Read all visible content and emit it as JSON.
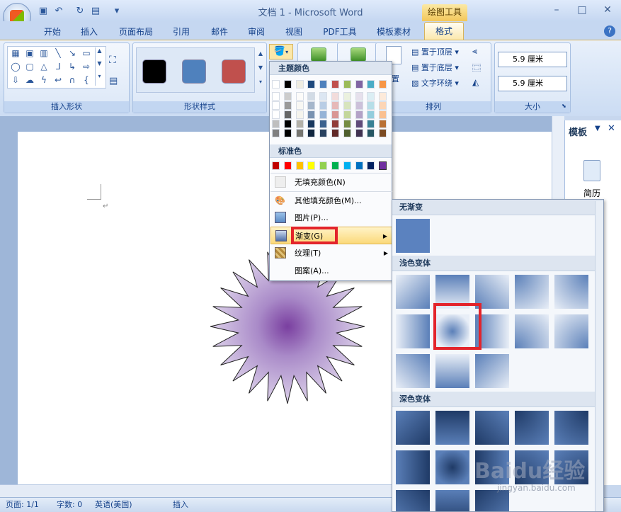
{
  "window": {
    "title": "文档 1 - Microsoft Word",
    "context_tab_group": "绘图工具"
  },
  "tabs": [
    "开始",
    "插入",
    "页面布局",
    "引用",
    "邮件",
    "审阅",
    "视图",
    "PDF工具",
    "模板素材",
    "格式"
  ],
  "active_tab": "格式",
  "ribbon": {
    "groups": {
      "insert_shapes": "插入形状",
      "shape_styles": "形状样式",
      "arrange": "排列",
      "size": "大小"
    },
    "arrange_items": {
      "bring_front": "置于顶层",
      "send_back": "置于底层",
      "text_wrap": "文字环绕",
      "position_partial": "置"
    },
    "size_values": {
      "height": "5.9 厘米",
      "width": "5.9 厘米"
    },
    "style_colors": [
      "#000000",
      "#4f81bd",
      "#c0504d"
    ]
  },
  "fill_dropdown": {
    "theme_header": "主题颜色",
    "standard_header": "标准色",
    "theme_top_row": [
      "#ffffff",
      "#000000",
      "#eeece1",
      "#1f497d",
      "#4f81bd",
      "#c0504d",
      "#9bbb59",
      "#8064a2",
      "#4bacc6",
      "#f79646"
    ],
    "standard_colors": [
      "#c00000",
      "#ff0000",
      "#ffc000",
      "#ffff00",
      "#92d050",
      "#00b050",
      "#00b0f0",
      "#0070c0",
      "#002060",
      "#7030a0"
    ],
    "items": {
      "no_fill": "无填充颜色(N)",
      "more_colors": "其他填充颜色(M)...",
      "picture": "图片(P)...",
      "gradient": "渐变(G)",
      "texture": "纹理(T)",
      "pattern": "图案(A)..."
    }
  },
  "gradient_menu": {
    "no_gradient": "无渐变",
    "light_variations": "浅色变体",
    "dark_variations": "深色变体"
  },
  "task_pane": {
    "title": "模板",
    "item": "简历"
  },
  "status": {
    "page": "页面: 1/1",
    "words": "字数: 0",
    "language": "英语(美国)",
    "mode": "插入"
  },
  "watermark": {
    "text": "Baidu经验",
    "url": "jingyan.baidu.com"
  },
  "document": {
    "paragraph_mark": "↵"
  }
}
